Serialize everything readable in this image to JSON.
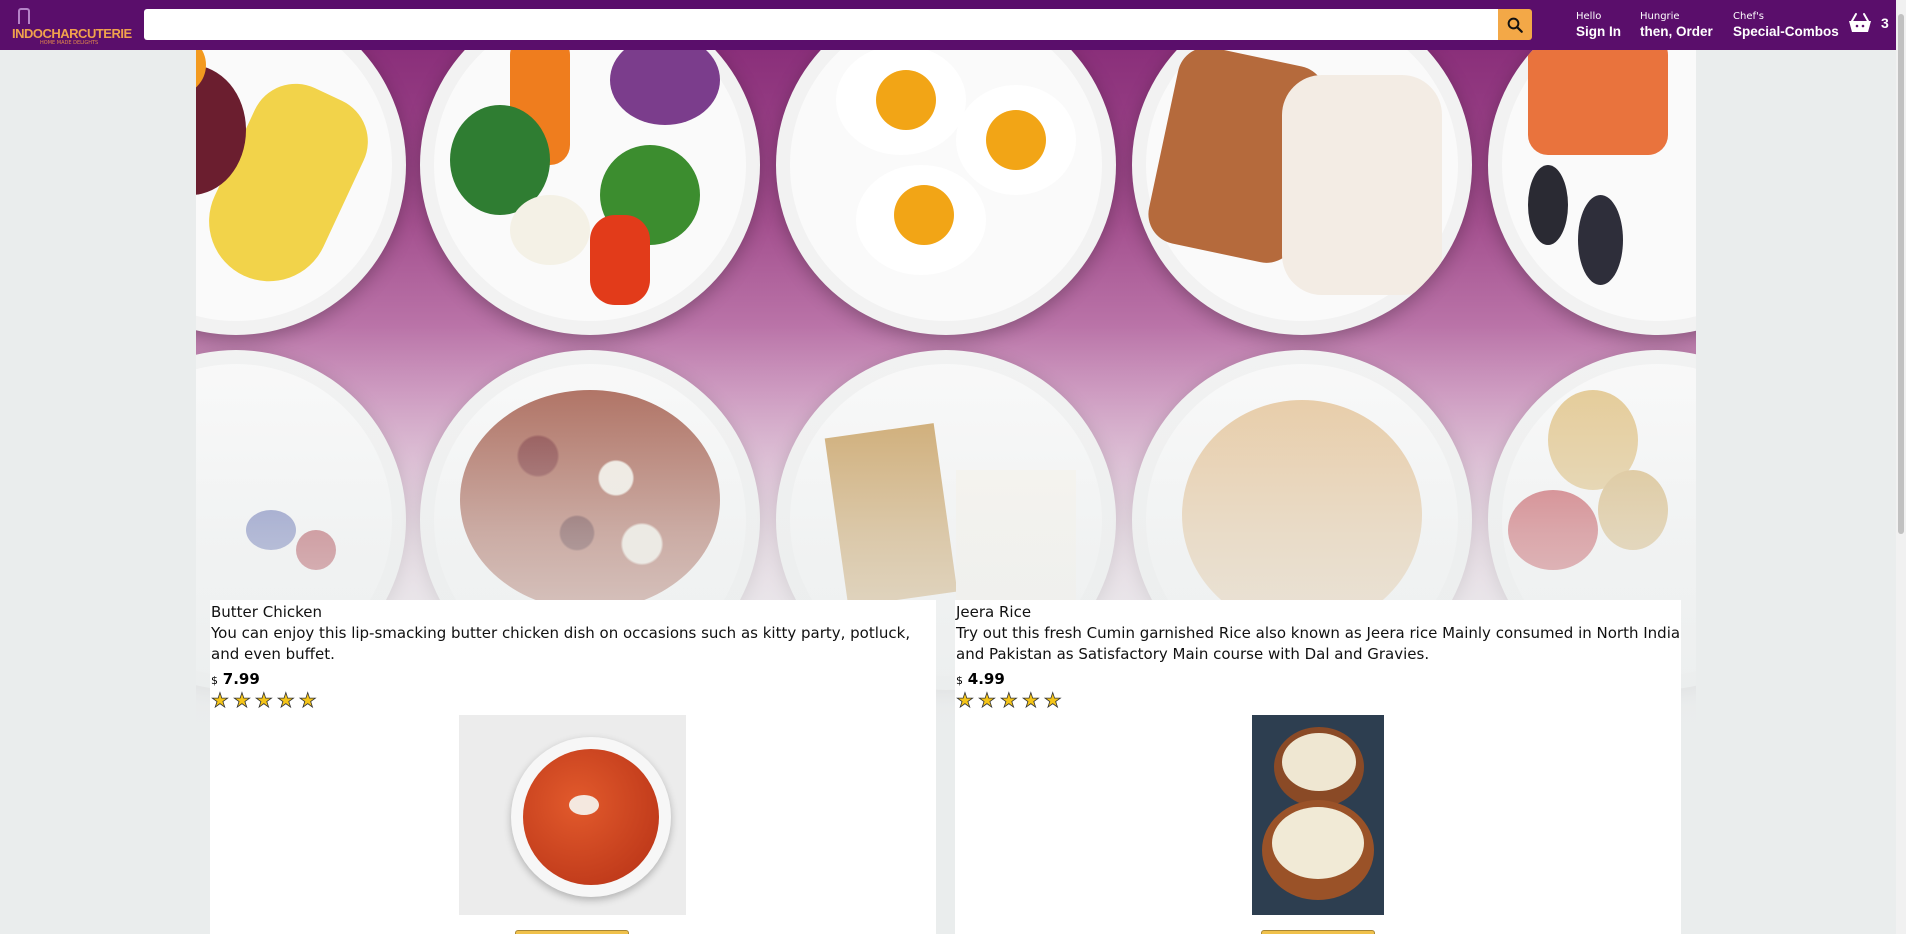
{
  "brand": {
    "name": "INDOCHARCUTERIE",
    "tagline": "HOME MADE DELIGHTS",
    "primary_color": "#5a0e6b",
    "accent_color": "#f3a847"
  },
  "search": {
    "placeholder": "",
    "value": "",
    "icon": "search-icon"
  },
  "nav": {
    "signin": {
      "line1": "Hello",
      "line2": "Sign In"
    },
    "orders": {
      "line1": "Hungrie",
      "line2": "then, Order"
    },
    "combos": {
      "line1": "Chef's",
      "line2": "Special-Combos"
    },
    "cart": {
      "icon": "basket-icon",
      "count": "3"
    }
  },
  "hero": {
    "image": "food-plates-banner"
  },
  "products": [
    {
      "name": "Butter Chicken",
      "description": "You can enjoy this lip-smacking butter chicken dish on occasions such as kitty party, potluck, and even buffet.",
      "currency": "$",
      "price": "7.99",
      "rating": 5,
      "image": "butter-chicken-bowl"
    },
    {
      "name": "Jeera Rice",
      "description": "Try out this fresh Cumin garnished Rice also known as Jeera rice Mainly consumed in North India and Pakistan as Satisfactory Main course with Dal and Gravies.",
      "currency": "$",
      "price": "4.99",
      "rating": 5,
      "image": "jeera-rice-bowls"
    }
  ]
}
